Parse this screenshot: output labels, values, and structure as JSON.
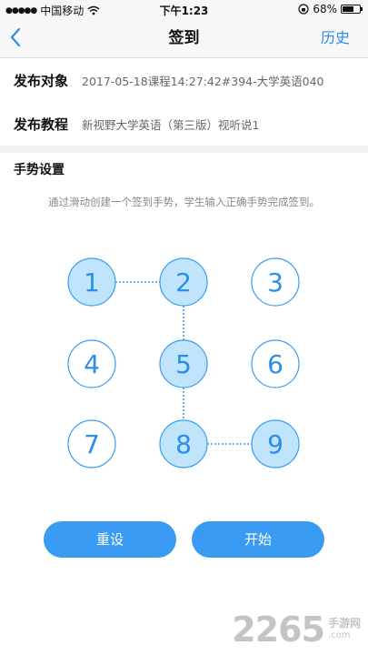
{
  "status_bar": {
    "signal_dots": "●●●●●",
    "carrier": "中国移动",
    "wifi_icon": "wifi-icon",
    "time": "下午1:23",
    "battery_percent": "68%",
    "battery_level": 0.68
  },
  "nav": {
    "back_icon": "chevron-left-icon",
    "back_glyph": "〈",
    "title": "签到",
    "history_label": "历史"
  },
  "form": {
    "target_label": "发布对象",
    "target_value": "2017-05-18课程14:27:42#394-大学英语040",
    "tutorial_label": "发布教程",
    "tutorial_value": "新视野大学英语（第三版）视听说1"
  },
  "gesture": {
    "section_title": "手势设置",
    "hint": "通过滑动创建一个签到手势，学生输入正确手势完成签到。",
    "nodes": [
      "1",
      "2",
      "3",
      "4",
      "5",
      "6",
      "7",
      "8",
      "9"
    ],
    "selected_sequence": [
      "1",
      "2",
      "5",
      "8",
      "9"
    ],
    "colors": {
      "selected_fill": "#bfe4fb",
      "stroke": "#3a9bf3",
      "text": "#2b8ee8"
    }
  },
  "buttons": {
    "reset_label": "重设",
    "start_label": "开始"
  },
  "watermark": {
    "logo": "2265",
    "suffix_cn": "手游网",
    "suffix_url": ".com"
  },
  "colors": {
    "accent": "#2b8ee8",
    "button": "#3a9bf3"
  }
}
